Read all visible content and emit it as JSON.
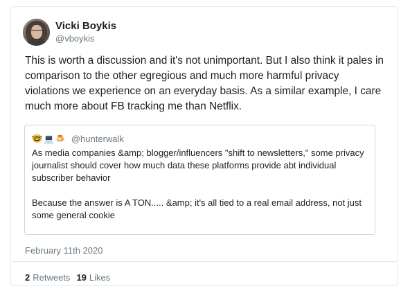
{
  "author": {
    "display_name": "Vicki Boykis",
    "handle": "@vboykis"
  },
  "tweet": {
    "text": "This is worth a discussion and it's not unimportant. But I also think it pales in comparison to the other egregious and much more harmful privacy violations we experience on an everyday basis. As a similar example, I care much more about FB tracking me than Netflix.",
    "timestamp": "February 11th 2020"
  },
  "quoted_tweet": {
    "emojis": [
      "🤓",
      "💻",
      "🍮"
    ],
    "handle": "@hunterwalk",
    "text": "As media companies &amp; blogger/influencers \"shift to newsletters,\" some privacy journalist should cover how much data these platforms provide abt individual subscriber behavior\n\nBecause the answer is A TON..... &amp; it's all tied to a real email address, not just some general cookie"
  },
  "stats": {
    "retweets_count": "2",
    "retweets_label": "Retweets",
    "likes_count": "19",
    "likes_label": "Likes"
  }
}
